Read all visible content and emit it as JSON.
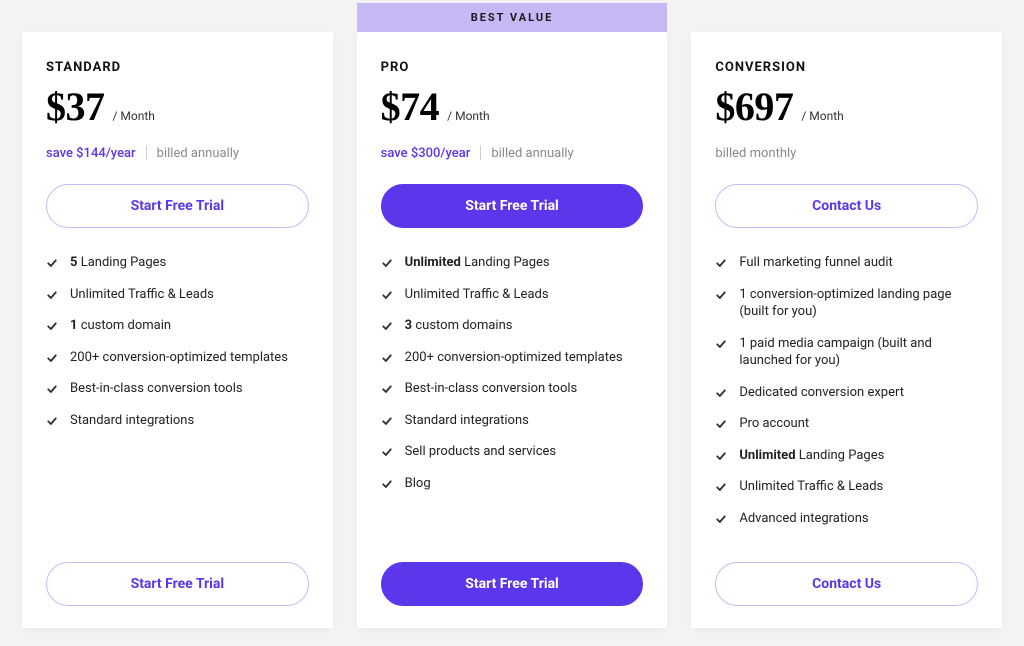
{
  "plans": [
    {
      "name": "STANDARD",
      "price": "$37",
      "per": "/ Month",
      "save": "save $144/year",
      "billing": "billed annually",
      "cta_top": "Start Free Trial",
      "cta_bottom": "Start Free Trial",
      "badge": null,
      "primary": false,
      "features": [
        {
          "bold": "5",
          "rest": " Landing Pages"
        },
        {
          "bold": null,
          "rest": "Unlimited Traffic & Leads"
        },
        {
          "bold": "1",
          "rest": " custom domain"
        },
        {
          "bold": null,
          "rest": "200+ conversion-optimized templates"
        },
        {
          "bold": null,
          "rest": "Best-in-class conversion tools"
        },
        {
          "bold": null,
          "rest": "Standard integrations"
        }
      ]
    },
    {
      "name": "PRO",
      "price": "$74",
      "per": "/ Month",
      "save": "save $300/year",
      "billing": "billed annually",
      "cta_top": "Start Free Trial",
      "cta_bottom": "Start Free Trial",
      "badge": "BEST VALUE",
      "primary": true,
      "features": [
        {
          "bold": "Unlimited",
          "rest": " Landing Pages"
        },
        {
          "bold": null,
          "rest": "Unlimited Traffic & Leads"
        },
        {
          "bold": "3",
          "rest": " custom domains"
        },
        {
          "bold": null,
          "rest": "200+ conversion-optimized templates"
        },
        {
          "bold": null,
          "rest": "Best-in-class conversion tools"
        },
        {
          "bold": null,
          "rest": "Standard integrations"
        },
        {
          "bold": null,
          "rest": "Sell products and services"
        },
        {
          "bold": null,
          "rest": "Blog"
        }
      ]
    },
    {
      "name": "CONVERSION",
      "price": "$697",
      "per": "/ Month",
      "save": null,
      "billing": "billed monthly",
      "cta_top": "Contact Us",
      "cta_bottom": "Contact Us",
      "badge": null,
      "primary": false,
      "features": [
        {
          "bold": null,
          "rest": "Full marketing funnel audit"
        },
        {
          "bold": null,
          "rest": "1 conversion-optimized landing page (built for you)"
        },
        {
          "bold": null,
          "rest": "1 paid media campaign (built and launched for you)"
        },
        {
          "bold": null,
          "rest": "Dedicated conversion expert"
        },
        {
          "bold": null,
          "rest": "Pro account"
        },
        {
          "bold": "Unlimited",
          "rest": " Landing Pages"
        },
        {
          "bold": null,
          "rest": "Unlimited Traffic & Leads"
        },
        {
          "bold": null,
          "rest": "Advanced integrations"
        }
      ]
    }
  ]
}
